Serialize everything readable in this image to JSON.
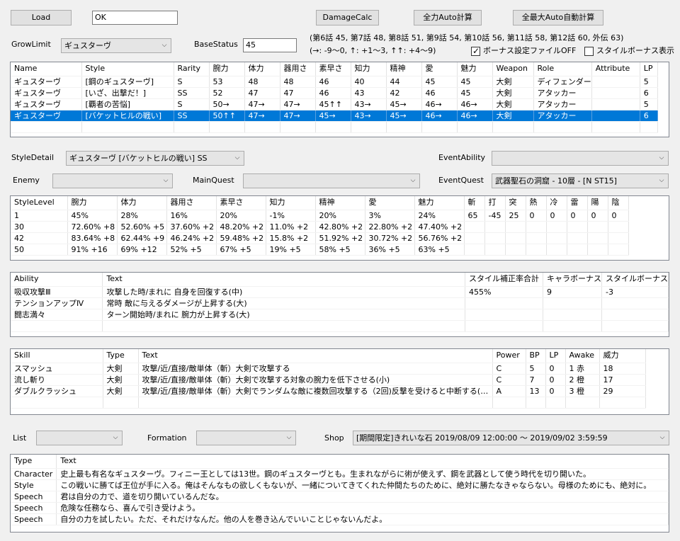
{
  "toolbar": {
    "load_label": "Load",
    "ok_value": "OK",
    "damagecalc_label": "DamageCalc",
    "full_auto_label": "全力Auto計算",
    "max_auto_label": "全最大Auto自動計算"
  },
  "growlimit": {
    "label": "GrowLimit",
    "value": "ギュスターヴ"
  },
  "basestatus": {
    "label": "BaseStatus",
    "value": "45"
  },
  "info": {
    "line1": "(第6話 45, 第7話 48, 第8話 51, 第9話 54, 第10話 56, 第11話 58, 第12話 60, 外伝 63)",
    "line2": "(→: -9～0, ↑: +1～3, ↑↑: +4～9)"
  },
  "checkboxes": {
    "bonus_file_off": {
      "label": "ボーナス設定ファイルOFF",
      "checked": true
    },
    "style_bonus": {
      "label": "スタイルボーナス表示",
      "checked": false
    }
  },
  "style_table": {
    "headers": [
      "Name",
      "Style",
      "Rarity",
      "腕力",
      "体力",
      "器用さ",
      "素早さ",
      "知力",
      "精神",
      "愛",
      "魅力",
      "Weapon",
      "Role",
      "Attribute",
      "LP"
    ],
    "rows": [
      [
        "ギュスターヴ",
        "[鋼のギュスターヴ]",
        "S",
        "53",
        "48",
        "48",
        "46",
        "40",
        "44",
        "45",
        "45",
        "大剣",
        "ディフェンダー",
        "",
        "5"
      ],
      [
        "ギュスターヴ",
        "[いざ、出撃だ！]",
        "SS",
        "52",
        "47",
        "47",
        "46",
        "43",
        "42",
        "46",
        "45",
        "大剣",
        "アタッカー",
        "",
        "6"
      ],
      [
        "ギュスターヴ",
        "[覇者の苦悩]",
        "S",
        "50→",
        "47→",
        "47→",
        "45↑↑",
        "43→",
        "45→",
        "46→",
        "46→",
        "大剣",
        "アタッカー",
        "",
        "5"
      ],
      [
        "ギュスターヴ",
        "[バケットヒルの戦い]",
        "SS",
        "50↑↑",
        "47→",
        "47→",
        "45→",
        "43→",
        "45→",
        "46→",
        "46→",
        "大剣",
        "アタッカー",
        "",
        "6"
      ]
    ],
    "selected_index": 3
  },
  "styledetail": {
    "label": "StyleDetail",
    "value": "ギュスターヴ [バケットヒルの戦い] SS"
  },
  "eventability": {
    "label": "EventAbility",
    "value": ""
  },
  "enemy": {
    "label": "Enemy",
    "value": ""
  },
  "mainquest": {
    "label": "MainQuest",
    "value": ""
  },
  "eventquest": {
    "label": "EventQuest",
    "value": "武器聖石の洞窟 - 10層 - [N ST15]"
  },
  "level_table": {
    "headers": [
      "StyleLevel",
      "腕力",
      "体力",
      "器用さ",
      "素早さ",
      "知力",
      "精神",
      "愛",
      "魅力",
      "斬",
      "打",
      "突",
      "熱",
      "冷",
      "雷",
      "陽",
      "陰"
    ],
    "rows": [
      [
        "1",
        "45%",
        "28%",
        "16%",
        "20%",
        "-1%",
        "20%",
        "3%",
        "24%",
        "65",
        "-45",
        "25",
        "0",
        "0",
        "0",
        "0",
        "0"
      ],
      [
        "30",
        "72.60% +8",
        "52.60% +5",
        "37.60% +2",
        "48.20% +2",
        "11.0% +2",
        "42.80% +2",
        "22.80% +2",
        "47.40% +2",
        "",
        "",
        "",
        "",
        "",
        "",
        "",
        ""
      ],
      [
        "42",
        "83.64% +8",
        "62.44% +9",
        "46.24% +2",
        "59.48% +2",
        "15.8% +2",
        "51.92% +2",
        "30.72% +2",
        "56.76% +2",
        "",
        "",
        "",
        "",
        "",
        "",
        "",
        ""
      ],
      [
        "50",
        "91% +16",
        "69% +12",
        "52% +5",
        "67% +5",
        "19% +5",
        "58% +5",
        "36% +5",
        "63% +5",
        "",
        "",
        "",
        "",
        "",
        "",
        "",
        ""
      ]
    ]
  },
  "ability_table": {
    "headers": [
      "Ability",
      "Text",
      "スタイル補正率合計",
      "キャラボーナス",
      "スタイルボーナス"
    ],
    "rows": [
      [
        "吸収攻撃Ⅲ",
        "攻撃した時/まれに  自身を回復する(中)",
        "455%",
        "9",
        "-3"
      ],
      [
        "テンションアップⅣ",
        "常時  敵に与えるダメージが上昇する(大)",
        "",
        "",
        ""
      ],
      [
        "闘志満々",
        "ターン開始時/まれに  腕力が上昇する(大)",
        "",
        "",
        ""
      ]
    ]
  },
  "skill_table": {
    "headers": [
      "Skill",
      "Type",
      "Text",
      "Power",
      "BP",
      "LP",
      "Awake",
      "威力"
    ],
    "rows": [
      [
        "スマッシュ",
        "大剣",
        "攻撃/近/直接/敵単体（斬）大剣で攻撃する",
        "C",
        "5",
        "0",
        "1 赤",
        "18"
      ],
      [
        "流し斬り",
        "大剣",
        "攻撃/近/直接/敵単体（斬）大剣で攻撃する対象の腕力を低下させる(小)",
        "C",
        "7",
        "0",
        "2 橙",
        "17"
      ],
      [
        "ダブルクラッシュ",
        "大剣",
        "攻撃/近/直接/敵単体（斬）大剣でランダムな敵に複数回攻撃する（2回)反撃を受けると中断する(…",
        "A",
        "13",
        "0",
        "3 橙",
        "29"
      ]
    ]
  },
  "list": {
    "label": "List",
    "value": ""
  },
  "formation": {
    "label": "Formation",
    "value": ""
  },
  "shop": {
    "label": "Shop",
    "value": "[期間限定]きれいな石 2019/08/09 12:00:00 ～ 2019/09/02 3:59:59"
  },
  "text_table": {
    "headers": [
      "Type",
      "Text"
    ],
    "rows": [
      [
        "Character",
        "史上最も有名なギュスターヴ。フィニー王としては13世。鋼のギュスターヴとも。生まれながらに術が使えず、鋼を武器として使う時代を切り開いた。"
      ],
      [
        "Style",
        "この戦いに勝てば王位が手に入る。俺はそんなもの欲しくもないが、一緒についてきてくれた仲間たちのために、絶対に勝たなきゃならない。母様のためにも、絶対に。"
      ],
      [
        "Speech",
        "君は自分の力で、道を切り開いているんだな。"
      ],
      [
        "Speech",
        "危険な任務なら、喜んで引き受けよう。"
      ],
      [
        "Speech",
        "自分の力を試したい。ただ、それだけなんだ。他の人を巻き込んでいいことじゃないんだよ。"
      ]
    ]
  },
  "icons": {
    "dropdown": "chevron-down-icon",
    "check": "check-mark-icon"
  }
}
